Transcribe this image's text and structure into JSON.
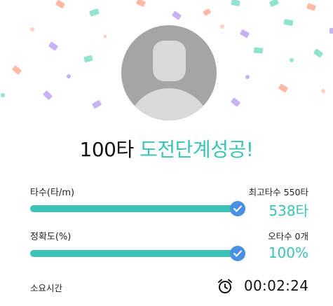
{
  "title": {
    "prefix": "100타",
    "accent": "도전단계성공!"
  },
  "speed": {
    "label": "타수(타/m)",
    "best": "최고타수 550타",
    "value": "538타",
    "progress": 0.98
  },
  "accuracy": {
    "label": "정확도(%)",
    "errors": "오타수 0개",
    "value": "100%",
    "progress": 1.0
  },
  "elapsed": {
    "label": "소요시간",
    "value": "00:02:24",
    "icon": "alarm-clock-icon"
  },
  "colors": {
    "accent": "#3cc3b5",
    "check": "#4a90e2",
    "confetti": [
      "#ffb8a6",
      "#c7b2f5",
      "#8fe3cf",
      "#ffd1c4"
    ]
  }
}
